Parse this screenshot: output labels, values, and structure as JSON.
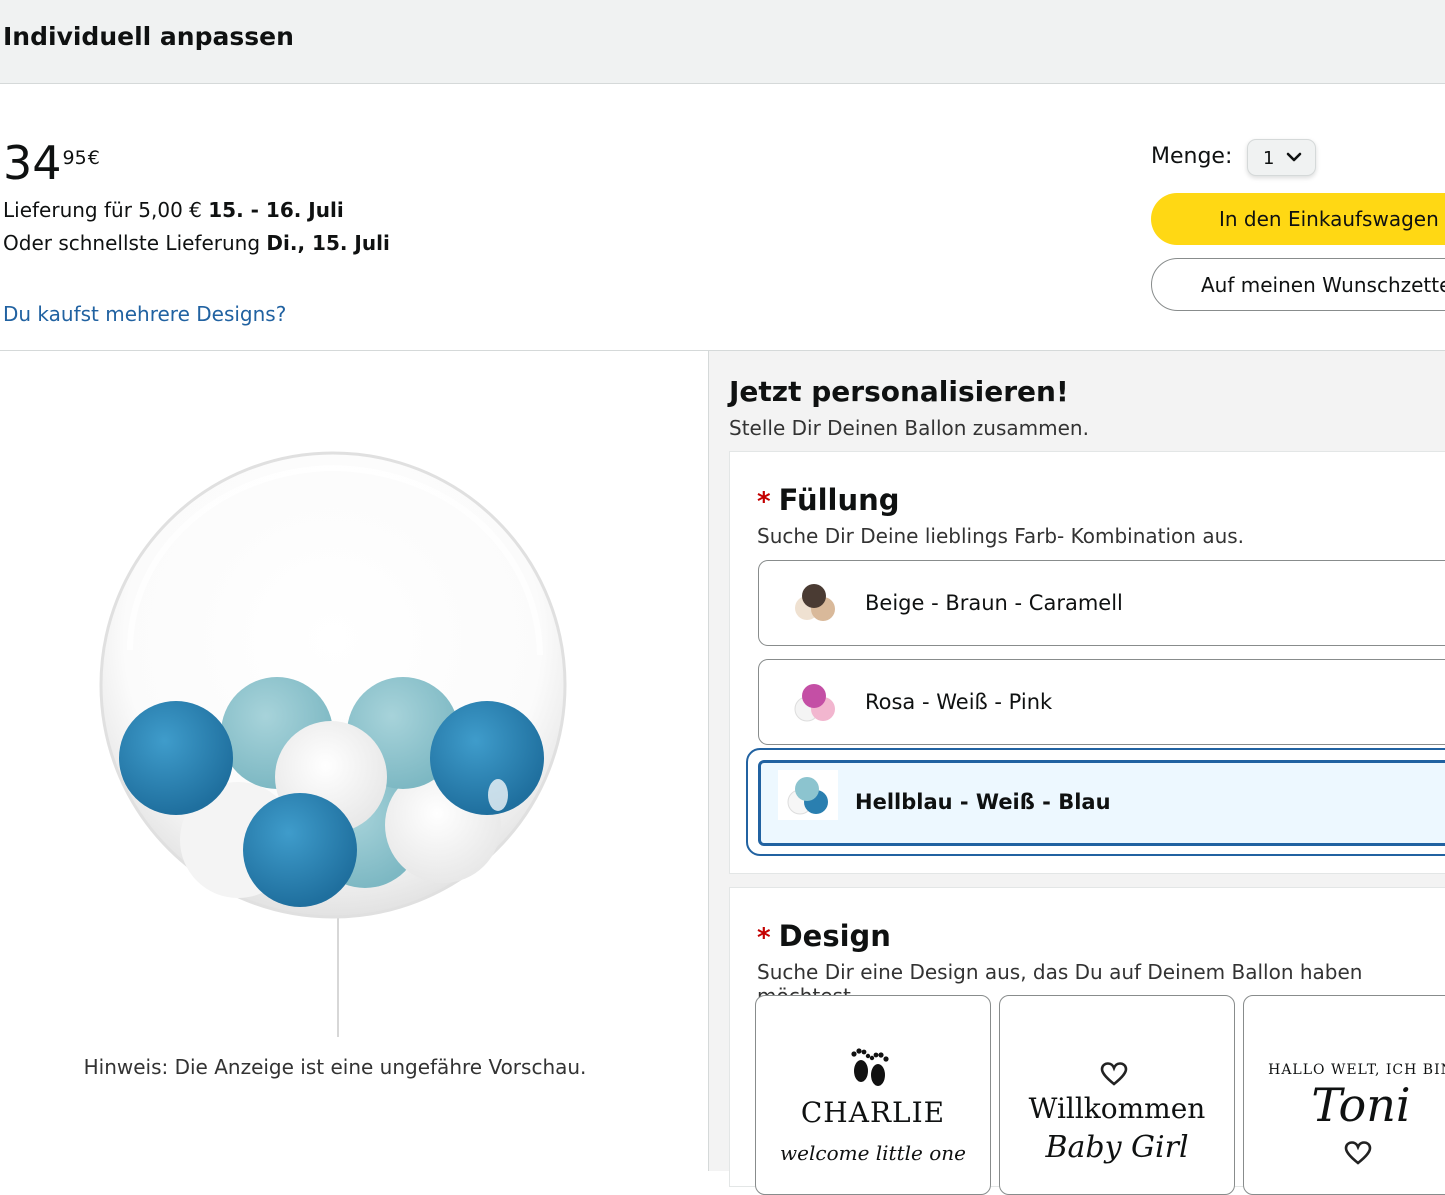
{
  "header": {
    "title": "Individuell anpassen"
  },
  "price": {
    "whole": "34",
    "fraction": "95",
    "currency": "€"
  },
  "delivery": {
    "line1_prefix": "Lieferung für 5,00 € ",
    "line1_date": "15. - 16. Juli",
    "line2_prefix": "Oder schnellste Lieferung ",
    "line2_date": "Di., 15. Juli"
  },
  "multi_design_link": "Du kaufst mehrere Designs?",
  "quantity": {
    "label": "Menge:",
    "value": "1"
  },
  "buttons": {
    "cart": "In den Einkaufswagen",
    "wishlist": "Auf meinen Wunschzettel"
  },
  "preview": {
    "note": "Hinweis: Die Anzeige ist eine ungefähre Vorschau."
  },
  "personalize": {
    "title": "Jetzt personalisieren!",
    "subtitle": "Stelle Dir Deinen Ballon zusammen."
  },
  "filling": {
    "required_mark": "*",
    "title": "Füllung",
    "subtitle": "Suche Dir Deine lieblings Farb- Kombination aus.",
    "options": [
      {
        "label": "Beige - Braun - Caramell",
        "colors": [
          "#4a3b33",
          "#efe1d1",
          "#d9b99a"
        ]
      },
      {
        "label": "Rosa - Weiß - Pink",
        "colors": [
          "#c44fa5",
          "#f4f4f4",
          "#f2b6cf"
        ]
      },
      {
        "label": "Hellblau - Weiß - Blau",
        "colors": [
          "#8cc4cf",
          "#f6f6f6",
          "#2a7fb0"
        ],
        "selected": true
      }
    ]
  },
  "design": {
    "required_mark": "*",
    "title": "Design",
    "subtitle": "Suche Dir eine Design aus, das Du auf Deinem Ballon haben möchtest.",
    "tiles": [
      {
        "name": "CHARLIE",
        "script": "welcome little one"
      },
      {
        "name": "Willkommen",
        "script": "Baby Girl"
      },
      {
        "name": "Toni",
        "script": "HALLO WELT, ICH BIN"
      }
    ]
  },
  "balloon_colors": {
    "light": "#8cc4cf",
    "dark": "#2a7fb0",
    "white": "#ffffff"
  }
}
